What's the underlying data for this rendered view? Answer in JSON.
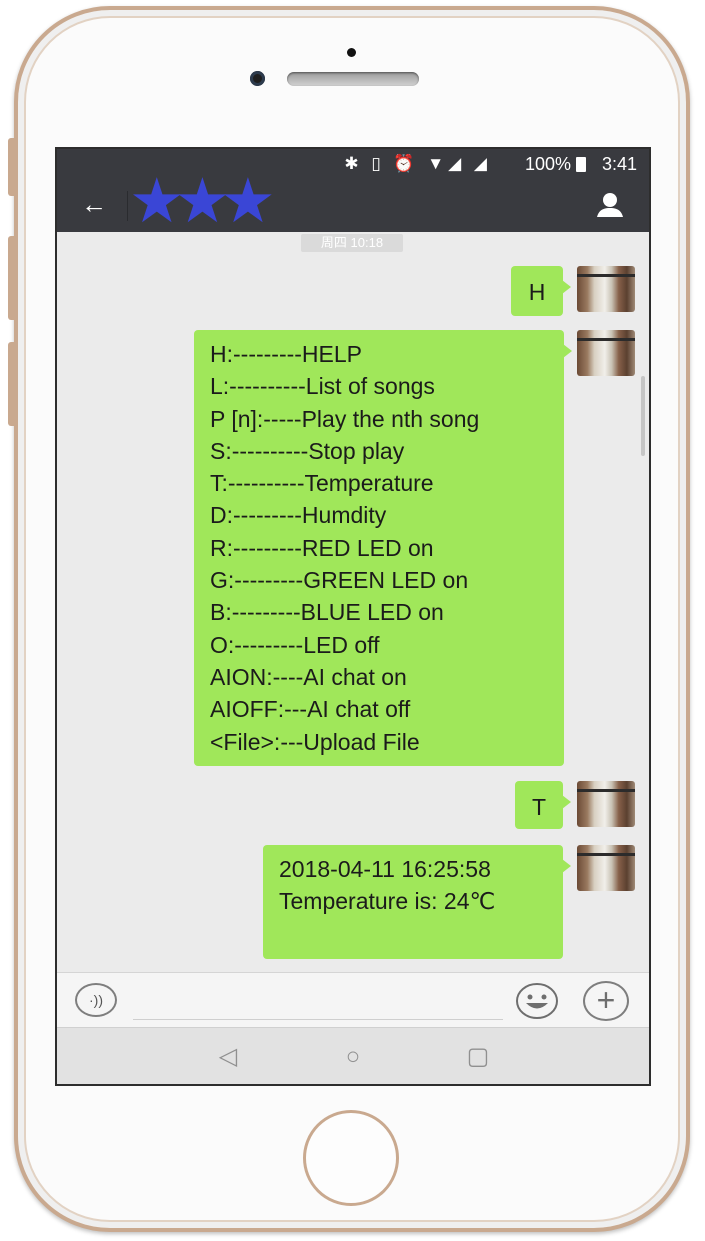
{
  "status_bar": {
    "icons": [
      "bluetooth-icon",
      "vibrate-icon",
      "alarm-icon",
      "wifi-icon",
      "signal-icon",
      "signal-icon",
      "battery-icon"
    ],
    "icon_glyphs": "✱ ▯ ⏰ ▼◢ ◢",
    "battery": "100%",
    "time": "3:41"
  },
  "title_bar": {
    "back_icon": "back-arrow-icon",
    "contact_name_redaction": "★★★",
    "profile_icon": "contact-profile-icon"
  },
  "chat": {
    "timestamp": "周四 10:18",
    "messages": [
      {
        "text": "H"
      },
      {
        "lines": [
          "H:---------HELP",
          "L:----------List of songs",
          "P [n]:-----Play the nth song",
          "S:----------Stop play",
          "T:----------Temperature",
          "D:---------Humdity",
          "R:---------RED LED on",
          "G:---------GREEN LED on",
          "B:---------BLUE LED on",
          "O:---------LED off",
          "AION:----AI chat on",
          "AIOFF:---AI chat off",
          "<File>:---Upload File"
        ]
      },
      {
        "text": "T"
      },
      {
        "lines": [
          "2018-04-11 16:25:58",
          "",
          "Temperature is: 24℃"
        ]
      }
    ]
  },
  "input_bar": {
    "voice_glyph": "·))",
    "plus_glyph": "+"
  },
  "nav_bar": {
    "back": "◁",
    "home": "○",
    "recents": "▢"
  },
  "colors": {
    "header": "#393a3f",
    "chat_background": "#ebebeb",
    "bubble": "#a0e75a",
    "redaction_stars": "#3a46d6"
  }
}
